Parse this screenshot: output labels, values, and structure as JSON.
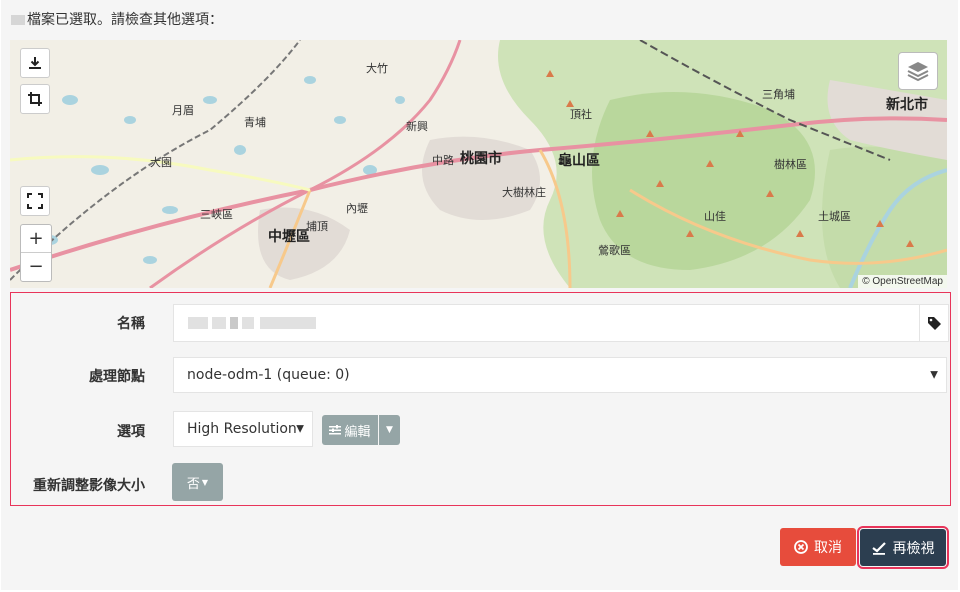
{
  "status_text": "檔案已選取。請檢查其他選項：",
  "map": {
    "attribution": "© OpenStreetMap",
    "labels": [
      {
        "text": "大竹"
      },
      {
        "text": "桃園市"
      },
      {
        "text": "龜山區"
      },
      {
        "text": "新北市"
      },
      {
        "text": "中壢區"
      },
      {
        "text": "大園"
      },
      {
        "text": "青埔"
      },
      {
        "text": "月眉"
      },
      {
        "text": "內壢"
      },
      {
        "text": "樹林區"
      },
      {
        "text": "土城區"
      },
      {
        "text": "鶯歌區"
      },
      {
        "text": "三峽區"
      },
      {
        "text": "中路"
      },
      {
        "text": "頂社"
      },
      {
        "text": "新興"
      },
      {
        "text": "山佳"
      },
      {
        "text": "三角埔"
      },
      {
        "text": "大樹林庄"
      },
      {
        "text": "埔頂"
      }
    ]
  },
  "form": {
    "name_label": "名稱",
    "node_label": "處理節點",
    "node_value": "node-odm-1 (queue: 0)",
    "options_label": "選項",
    "options_value": "High Resolution",
    "edit_label": "編輯",
    "resize_label": "重新調整影像大小",
    "resize_value": "否"
  },
  "actions": {
    "cancel": "取消",
    "review": "再檢視"
  },
  "colors": {
    "danger": "#e74c3c",
    "dark": "#2c3e50",
    "gray": "#95a5a6",
    "highlight": "#e8345a"
  }
}
